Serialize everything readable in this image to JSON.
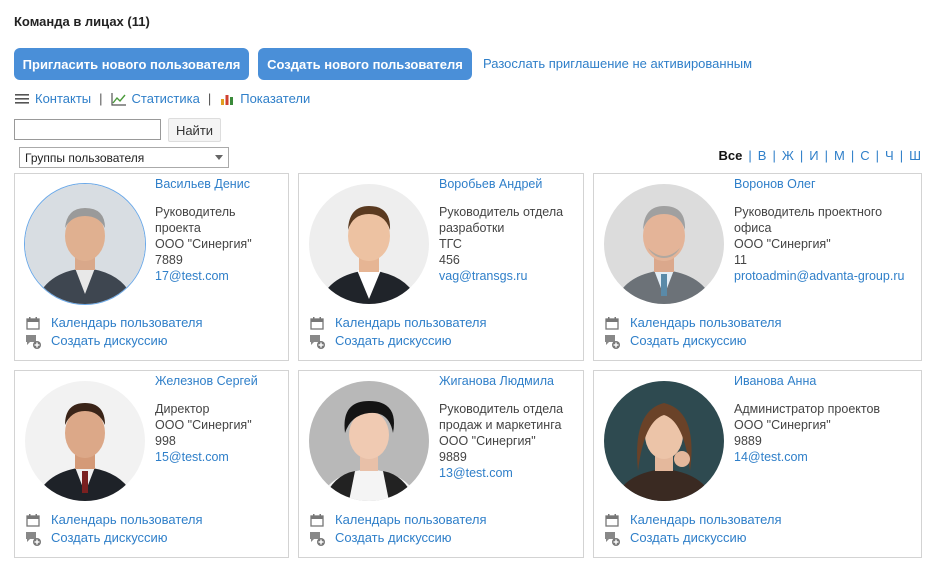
{
  "page": {
    "title": "Команда в лицах (11)"
  },
  "toolbar": {
    "invite_label": "Пригласить нового пользователя",
    "create_label": "Создать нового пользователя",
    "resend_label": "Разослать приглашение не активированным"
  },
  "nav": {
    "contacts": "Контакты",
    "stats": "Статистика",
    "indicators": "Показатели",
    "separator": "|"
  },
  "search": {
    "value": "",
    "button": "Найти"
  },
  "groups": {
    "selected": "Группы пользователя"
  },
  "alphabet": {
    "all": "Все",
    "letters": [
      "В",
      "Ж",
      "И",
      "М",
      "С",
      "Ч",
      "Ш"
    ],
    "separator": "|"
  },
  "actions": {
    "calendar": "Календарь пользователя",
    "discussion": "Создать дискуссию"
  },
  "colors": {
    "accent": "#4a8fd8",
    "link": "#2f7fc9"
  },
  "users": [
    {
      "name": "Васильев Денис",
      "position": [
        "Руководитель",
        "проекта"
      ],
      "company": "ООО \"Синергия\"",
      "phone": "7889",
      "email": "17@test.com",
      "selected": true
    },
    {
      "name": "Воробьев Андрей",
      "position": [
        "Руководитель отдела",
        "разработки"
      ],
      "company": "ТГС",
      "phone": "456",
      "email": "vag@transgs.ru",
      "selected": false
    },
    {
      "name": "Воронов Олег",
      "position": [
        "Руководитель проектного",
        "офиса"
      ],
      "company": "ООО \"Синергия\"",
      "phone": "11",
      "email": "protoadmin@advanta-group.ru",
      "selected": false
    },
    {
      "name": "Железнов Сергей",
      "position": [
        "Директор"
      ],
      "company": "ООО \"Синергия\"",
      "phone": "998",
      "email": "15@test.com",
      "selected": false
    },
    {
      "name": "Жиганова Людмила",
      "position": [
        "Руководитель отдела",
        "продаж и маркетинга"
      ],
      "company": "ООО \"Синергия\"",
      "phone": "9889",
      "email": "13@test.com",
      "selected": false
    },
    {
      "name": "Иванова Анна",
      "position": [
        "Администратор проектов"
      ],
      "company": "ООО \"Синергия\"",
      "phone": "9889",
      "email": "14@test.com",
      "selected": false
    }
  ]
}
